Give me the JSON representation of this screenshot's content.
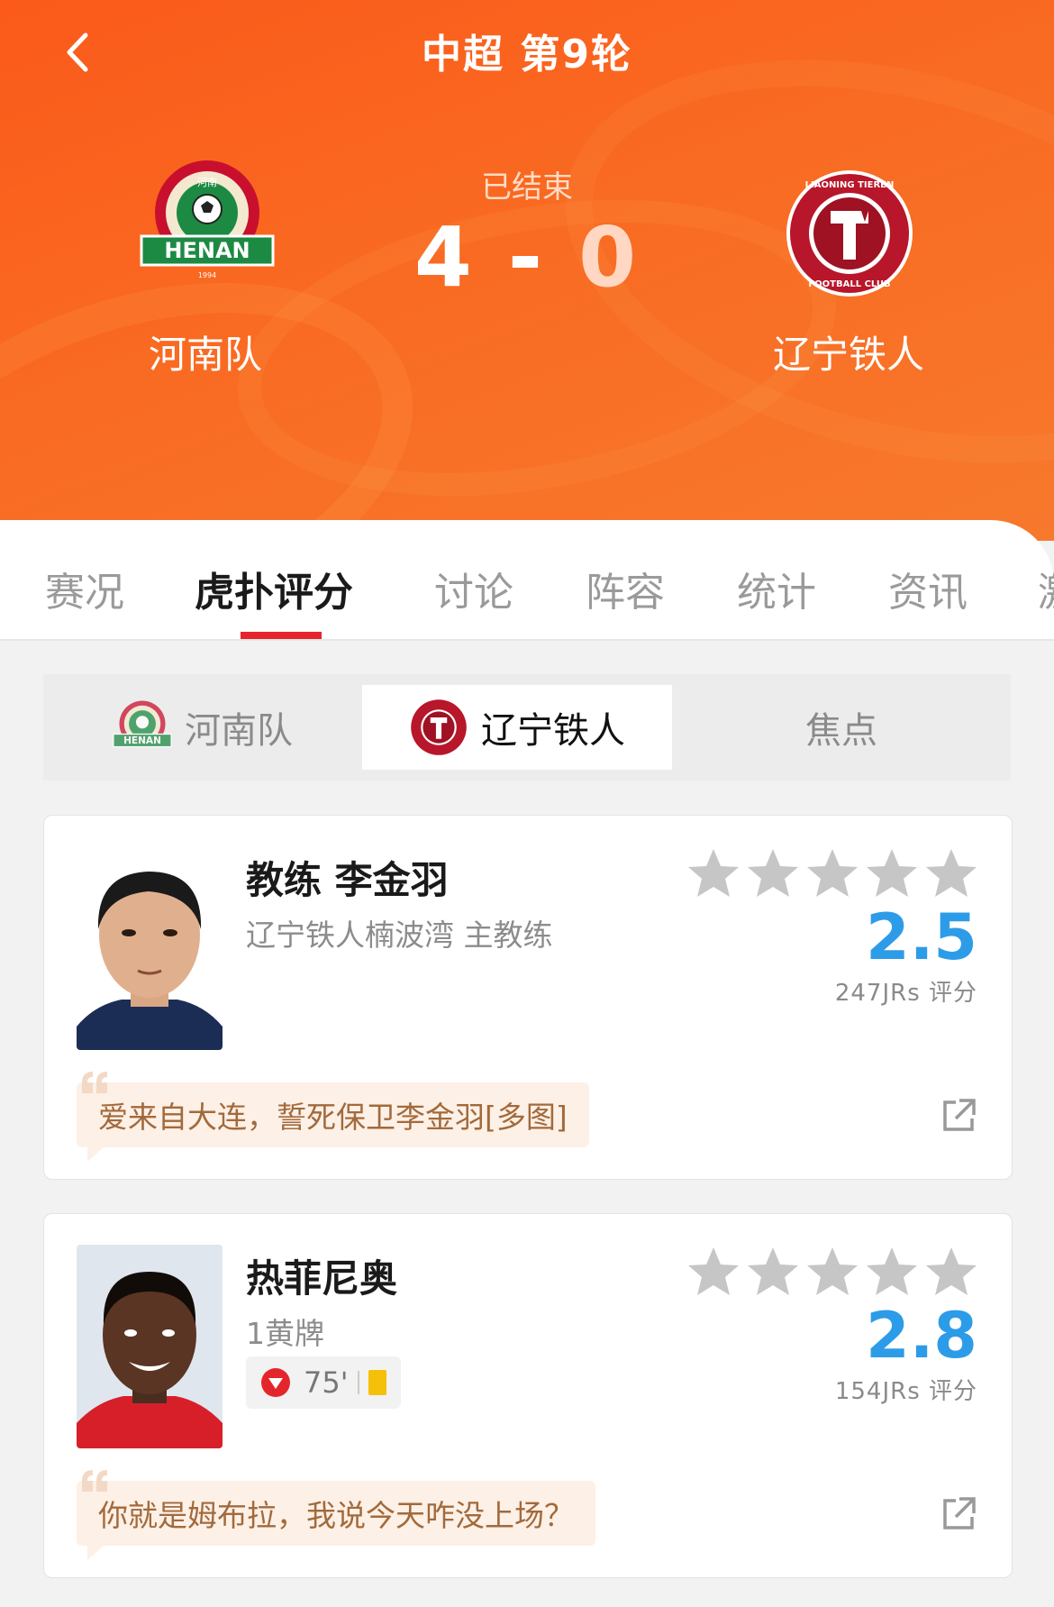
{
  "header": {
    "title": "中超 第9轮",
    "status": "已结束",
    "home_score": "4",
    "score_sep": "-",
    "away_score": "0",
    "home_team": "河南队",
    "away_team": "辽宁铁人",
    "home_logo_text": "HENAN",
    "home_logo_year": "1994",
    "home_logo_top": "河南",
    "away_logo_text": "LIAONING TIEREN",
    "away_logo_sub": "FOOTBALL CLUB",
    "accent": "#f96a22"
  },
  "tabs": [
    {
      "label": "赛况",
      "active": false
    },
    {
      "label": "虎扑评分",
      "active": true
    },
    {
      "label": "讨论",
      "active": false
    },
    {
      "label": "阵容",
      "active": false
    },
    {
      "label": "统计",
      "active": false
    },
    {
      "label": "资讯",
      "active": false
    },
    {
      "label": "激",
      "active": false
    }
  ],
  "team_switch": [
    {
      "label": "河南队",
      "icon": "henan-logo",
      "active": false
    },
    {
      "label": "辽宁铁人",
      "icon": "tieren-logo",
      "active": true
    },
    {
      "label": "焦点",
      "active": false
    }
  ],
  "ratings": [
    {
      "name": "教练 李金羽",
      "subtitle": "辽宁铁人楠波湾 主教练",
      "rating": "2.5",
      "votes": "247JRs 评分",
      "quote": "爱来自大连，誓死保卫李金羽[多图]"
    },
    {
      "name": "热菲尼奥",
      "subtitle": "1黄牌",
      "event_minute": "75'",
      "rating": "2.8",
      "votes": "154JRs 评分",
      "quote": "你就是姆布拉，我说今天咋没上场？"
    }
  ],
  "colors": {
    "rating_blue": "#2d9ce8",
    "tab_indicator": "#e4262c",
    "quote_bg": "#fdf0e6",
    "quote_text": "#a26a3c"
  }
}
